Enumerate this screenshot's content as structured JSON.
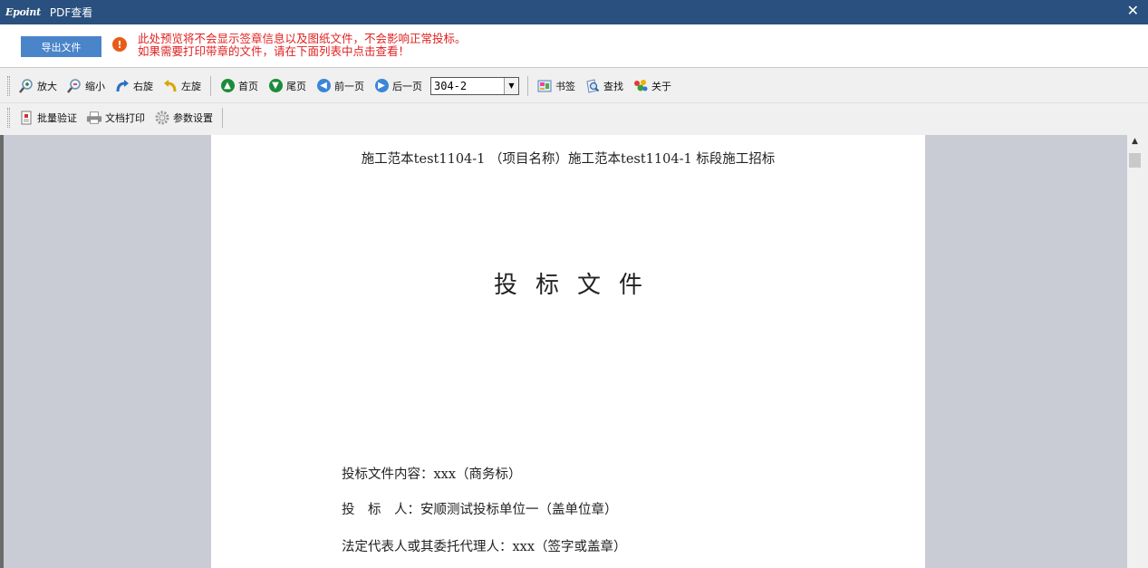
{
  "window": {
    "brand": "Epoint",
    "title": "PDF查看",
    "close_glyph": "✕"
  },
  "notice": {
    "export_label": "导出文件",
    "warn_glyph": "!",
    "line1": "此处预览将不会显示签章信息以及图纸文件，不会影响正常投标。",
    "line2": "如果需要打印带章的文件，请在下面列表中点击查看！",
    "color": "#e12020"
  },
  "toolbar1": {
    "zoom_in": "放大",
    "zoom_out": "缩小",
    "rotate_right": "右旋",
    "rotate_left": "左旋",
    "first_page": "首页",
    "last_page": "尾页",
    "prev_page": "前一页",
    "next_page": "后一页",
    "page_value": "304-2",
    "bookmark": "书签",
    "find": "查找",
    "about": "关于"
  },
  "toolbar2": {
    "batch_verify": "批量验证",
    "print": "文档打印",
    "settings": "参数设置"
  },
  "document": {
    "header": "施工范本test1104-1 （项目名称）施工范本test1104-1 标段施工招标",
    "title": "投标文件",
    "content_line": "投标文件内容：xxx（商务标）",
    "bidder_line": "投　标　人：安顺测试投标单位一（盖单位章）",
    "rep_line": "法定代表人或其委托代理人：xxx（签字或盖章）"
  },
  "colors": {
    "titlebar": "#29507e",
    "export_button": "#4a84c9",
    "warn_icon": "#e85b17",
    "viewer_bg": "#c9ccd5"
  }
}
